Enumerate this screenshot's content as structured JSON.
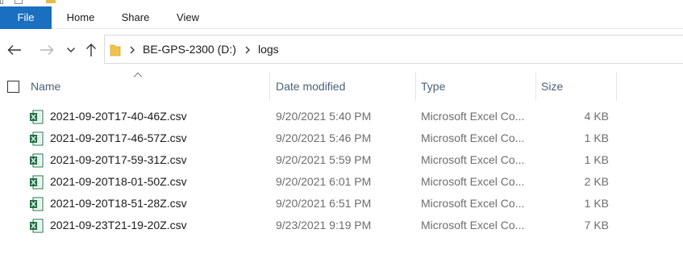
{
  "ribbon": {
    "tabs": [
      {
        "label": "File"
      },
      {
        "label": "Home"
      },
      {
        "label": "Share"
      },
      {
        "label": "View"
      }
    ]
  },
  "nav": {
    "icons": [
      "back-arrow-icon",
      "forward-arrow-icon",
      "recent-locations-chevron-icon",
      "up-arrow-icon"
    ]
  },
  "address": {
    "segments": [
      "BE-GPS-2300 (D:)",
      "logs"
    ]
  },
  "columns": {
    "name": "Name",
    "date": "Date modified",
    "type": "Type",
    "size": "Size"
  },
  "files": [
    {
      "name": "2021-09-20T17-40-46Z.csv",
      "date": "9/20/2021 5:40 PM",
      "type": "Microsoft Excel Co...",
      "size": "4 KB"
    },
    {
      "name": "2021-09-20T17-46-57Z.csv",
      "date": "9/20/2021 5:46 PM",
      "type": "Microsoft Excel Co...",
      "size": "1 KB"
    },
    {
      "name": "2021-09-20T17-59-31Z.csv",
      "date": "9/20/2021 5:59 PM",
      "type": "Microsoft Excel Co...",
      "size": "1 KB"
    },
    {
      "name": "2021-09-20T18-01-50Z.csv",
      "date": "9/20/2021 6:01 PM",
      "type": "Microsoft Excel Co...",
      "size": "2 KB"
    },
    {
      "name": "2021-09-20T18-51-28Z.csv",
      "date": "9/20/2021 6:51 PM",
      "type": "Microsoft Excel Co...",
      "size": "1 KB"
    },
    {
      "name": "2021-09-23T21-19-20Z.csv",
      "date": "9/23/2021 9:19 PM",
      "type": "Microsoft Excel Co...",
      "size": "7 KB"
    }
  ],
  "colors": {
    "file_tab": "#1a6fc1",
    "header_text": "#4c607a",
    "excel_green": "#1e7145"
  }
}
